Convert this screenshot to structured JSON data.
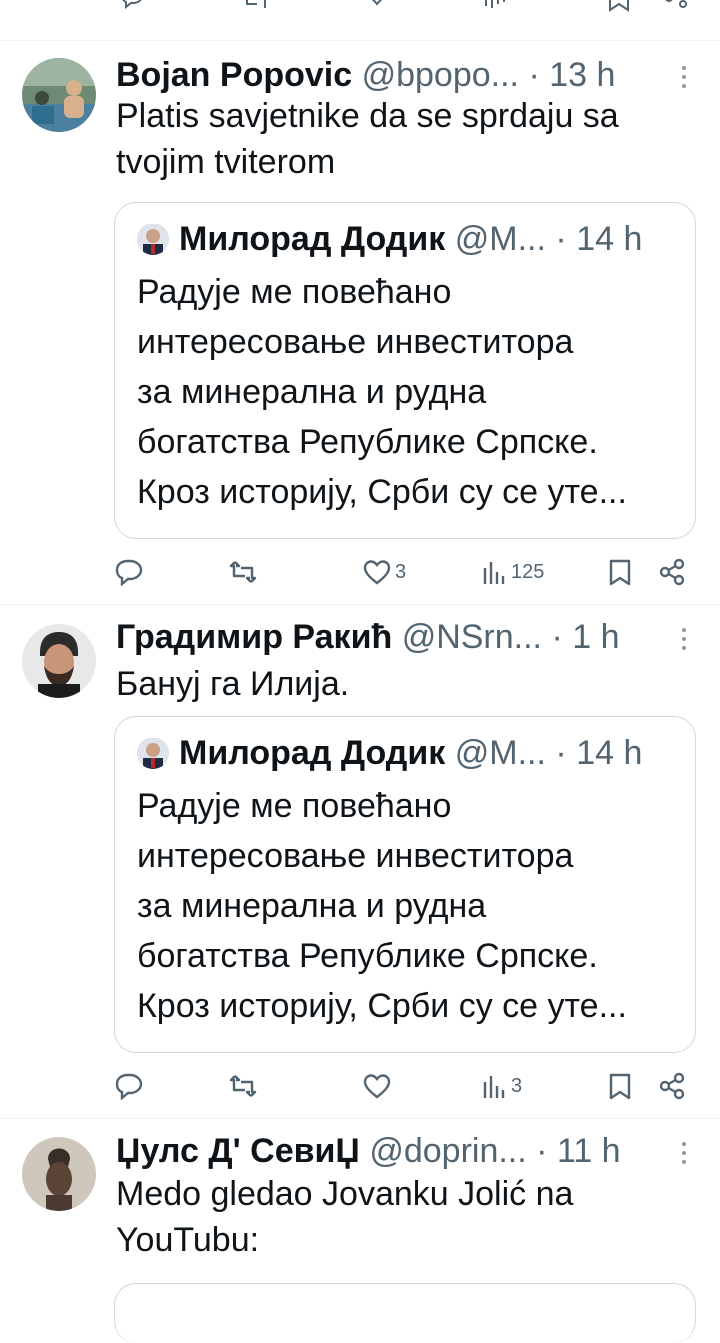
{
  "colors": {
    "text": "#0f1419",
    "secondary": "#536471",
    "border": "#cfd9de",
    "divider": "#eff3f4"
  },
  "tweets": [
    {
      "name": "Bojan Popovic",
      "handle": "@bpopo...",
      "dot": "·",
      "time": "13 h",
      "text_lines": [
        "Platis savjetnike da se sprdaju sa",
        "tvojim tviterom"
      ],
      "quote": {
        "name": "Милорад Додик",
        "handle": "@М...",
        "dot": "·",
        "time": "14 h",
        "lines": [
          "Радује ме повећано",
          "интересовање инвеститора",
          "за минерална и рудна",
          "богатства Републике Српске.",
          "Кроз историју, Срби су се уте..."
        ]
      },
      "stats": {
        "replies": "",
        "reposts": "",
        "likes": "3",
        "views": "125"
      }
    },
    {
      "name": "Градимир Ракић",
      "handle": "@NSrn...",
      "dot": "·",
      "time": "1 h",
      "text_lines": [
        "Бануј га Илија."
      ],
      "quote": {
        "name": "Милорад Додик",
        "handle": "@М...",
        "dot": "·",
        "time": "14 h",
        "lines": [
          "Радује ме повећано",
          "интересовање инвеститора",
          "за минерална и рудна",
          "богатства Републике Српске.",
          "Кроз историју, Срби су се уте..."
        ]
      },
      "stats": {
        "replies": "",
        "reposts": "",
        "likes": "",
        "views": "3"
      }
    },
    {
      "name": "Џулс Д' СевиЏ",
      "handle": "@doprin...",
      "dot": "·",
      "time": "11 h",
      "text_lines": [
        "Medo gledao Jovanku Jolić na",
        "YouTubu:"
      ]
    }
  ]
}
